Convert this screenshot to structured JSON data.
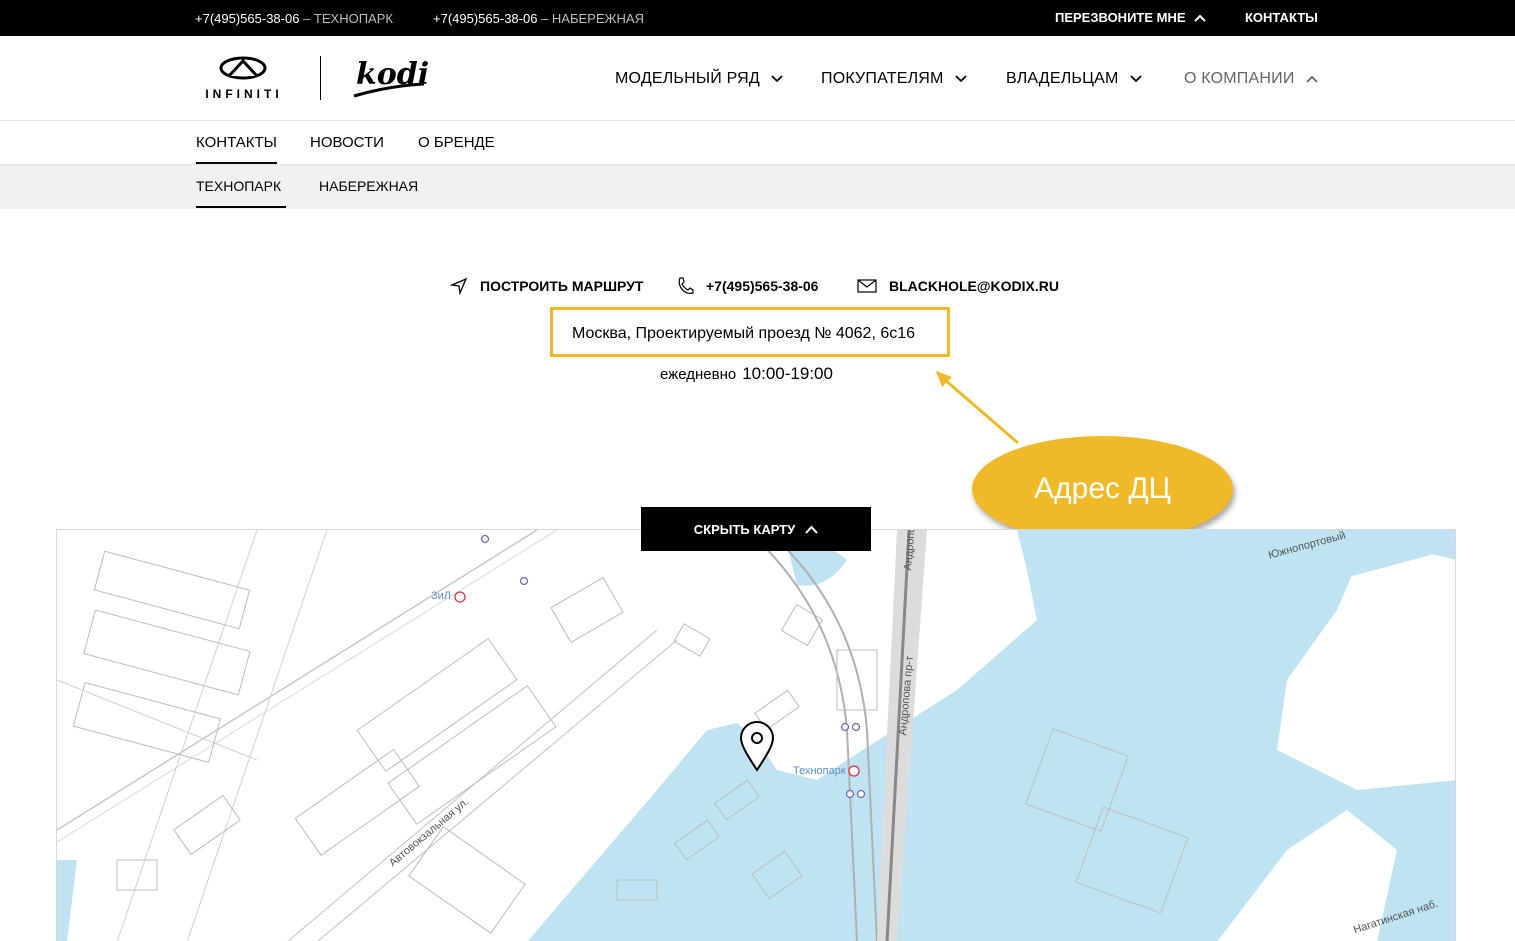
{
  "topbar": {
    "phone1": "+7(495)565-38-06",
    "loc1": " – ТЕХНОПАРК",
    "phone2": "+7(495)565-38-06",
    "loc2": " – НАБЕРЕЖНАЯ",
    "callback": "ПЕРЕЗВОНИТЕ МНЕ",
    "contacts": "КОНТАКТЫ"
  },
  "header": {
    "logo1_text": "INFINITI",
    "logo2_text": "kodix",
    "nav": [
      {
        "label": "МОДЕЛЬНЫЙ РЯД"
      },
      {
        "label": "ПОКУПАТЕЛЯМ"
      },
      {
        "label": "ВЛАДЕЛЬЦАМ"
      },
      {
        "label": "О КОМПАНИИ"
      }
    ]
  },
  "subnav": {
    "tabs": [
      {
        "label": "КОНТАКТЫ"
      },
      {
        "label": "НОВОСТИ"
      },
      {
        "label": "О БРЕНДЕ"
      }
    ]
  },
  "subnav2": {
    "tabs": [
      {
        "label": "ТЕХНОПАРК"
      },
      {
        "label": "НАБЕРЕЖНАЯ"
      }
    ]
  },
  "contact": {
    "route_label": "ПОСТРОИТЬ МАРШРУТ",
    "phone": "+7(495)565-38-06",
    "email": "BLACKHOLE@KODIX.RU",
    "address": "Москва, Проектируемый проезд № 4062, 6с16",
    "hours_label": "ежедневно",
    "hours_time": "10:00-19:00"
  },
  "annotation": {
    "bubble_text": "Адрес ДЦ",
    "color": "#f0b92a"
  },
  "map": {
    "hide_button": "СКРЫТЬ КАРТУ",
    "station1": "ЗиЛ",
    "station2": "Технопарк",
    "street1": "Андропова",
    "street2": "Андропова пр-т",
    "street3": "Автовокзальная ул.",
    "street4": "Южнопортовый",
    "street5": "Нагатинская наб.",
    "water_color": "#bfe3f3"
  }
}
